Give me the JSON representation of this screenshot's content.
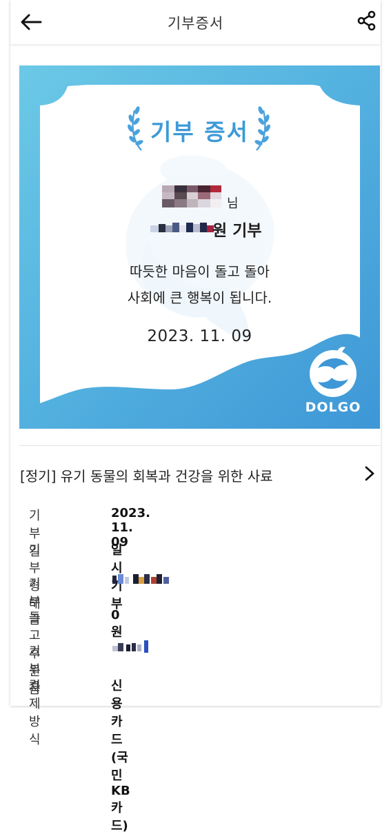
{
  "header": {
    "title": "기부증서"
  },
  "certificate": {
    "heading": "기부 증서",
    "honorific": "님",
    "amount_suffix": "원 기부",
    "message_line1": "따듯한 마음이 돌고 돌아",
    "message_line2": "사회에 큰 행복이 됩니다.",
    "date": "2023. 11. 09",
    "brand": "DOLGO"
  },
  "campaign": {
    "title": "[정기] 유기 동물의 회복과 건강을 위한 사료"
  },
  "details": [
    {
      "label": "기부일",
      "value": "2023. 11. 09"
    },
    {
      "label": "기부형태",
      "value": "일시기부"
    },
    {
      "label": "기부금",
      "value": ""
    },
    {
      "label": "돌고후원금",
      "value": "0원"
    },
    {
      "label": "기부자",
      "value": ""
    },
    {
      "label": "결제방식",
      "value": "신용카드(국민KB카드)"
    }
  ],
  "colors": {
    "accent": "#3d9ad8",
    "cert_gradient_start": "#6cc9e6",
    "cert_gradient_end": "#3e97d6"
  }
}
